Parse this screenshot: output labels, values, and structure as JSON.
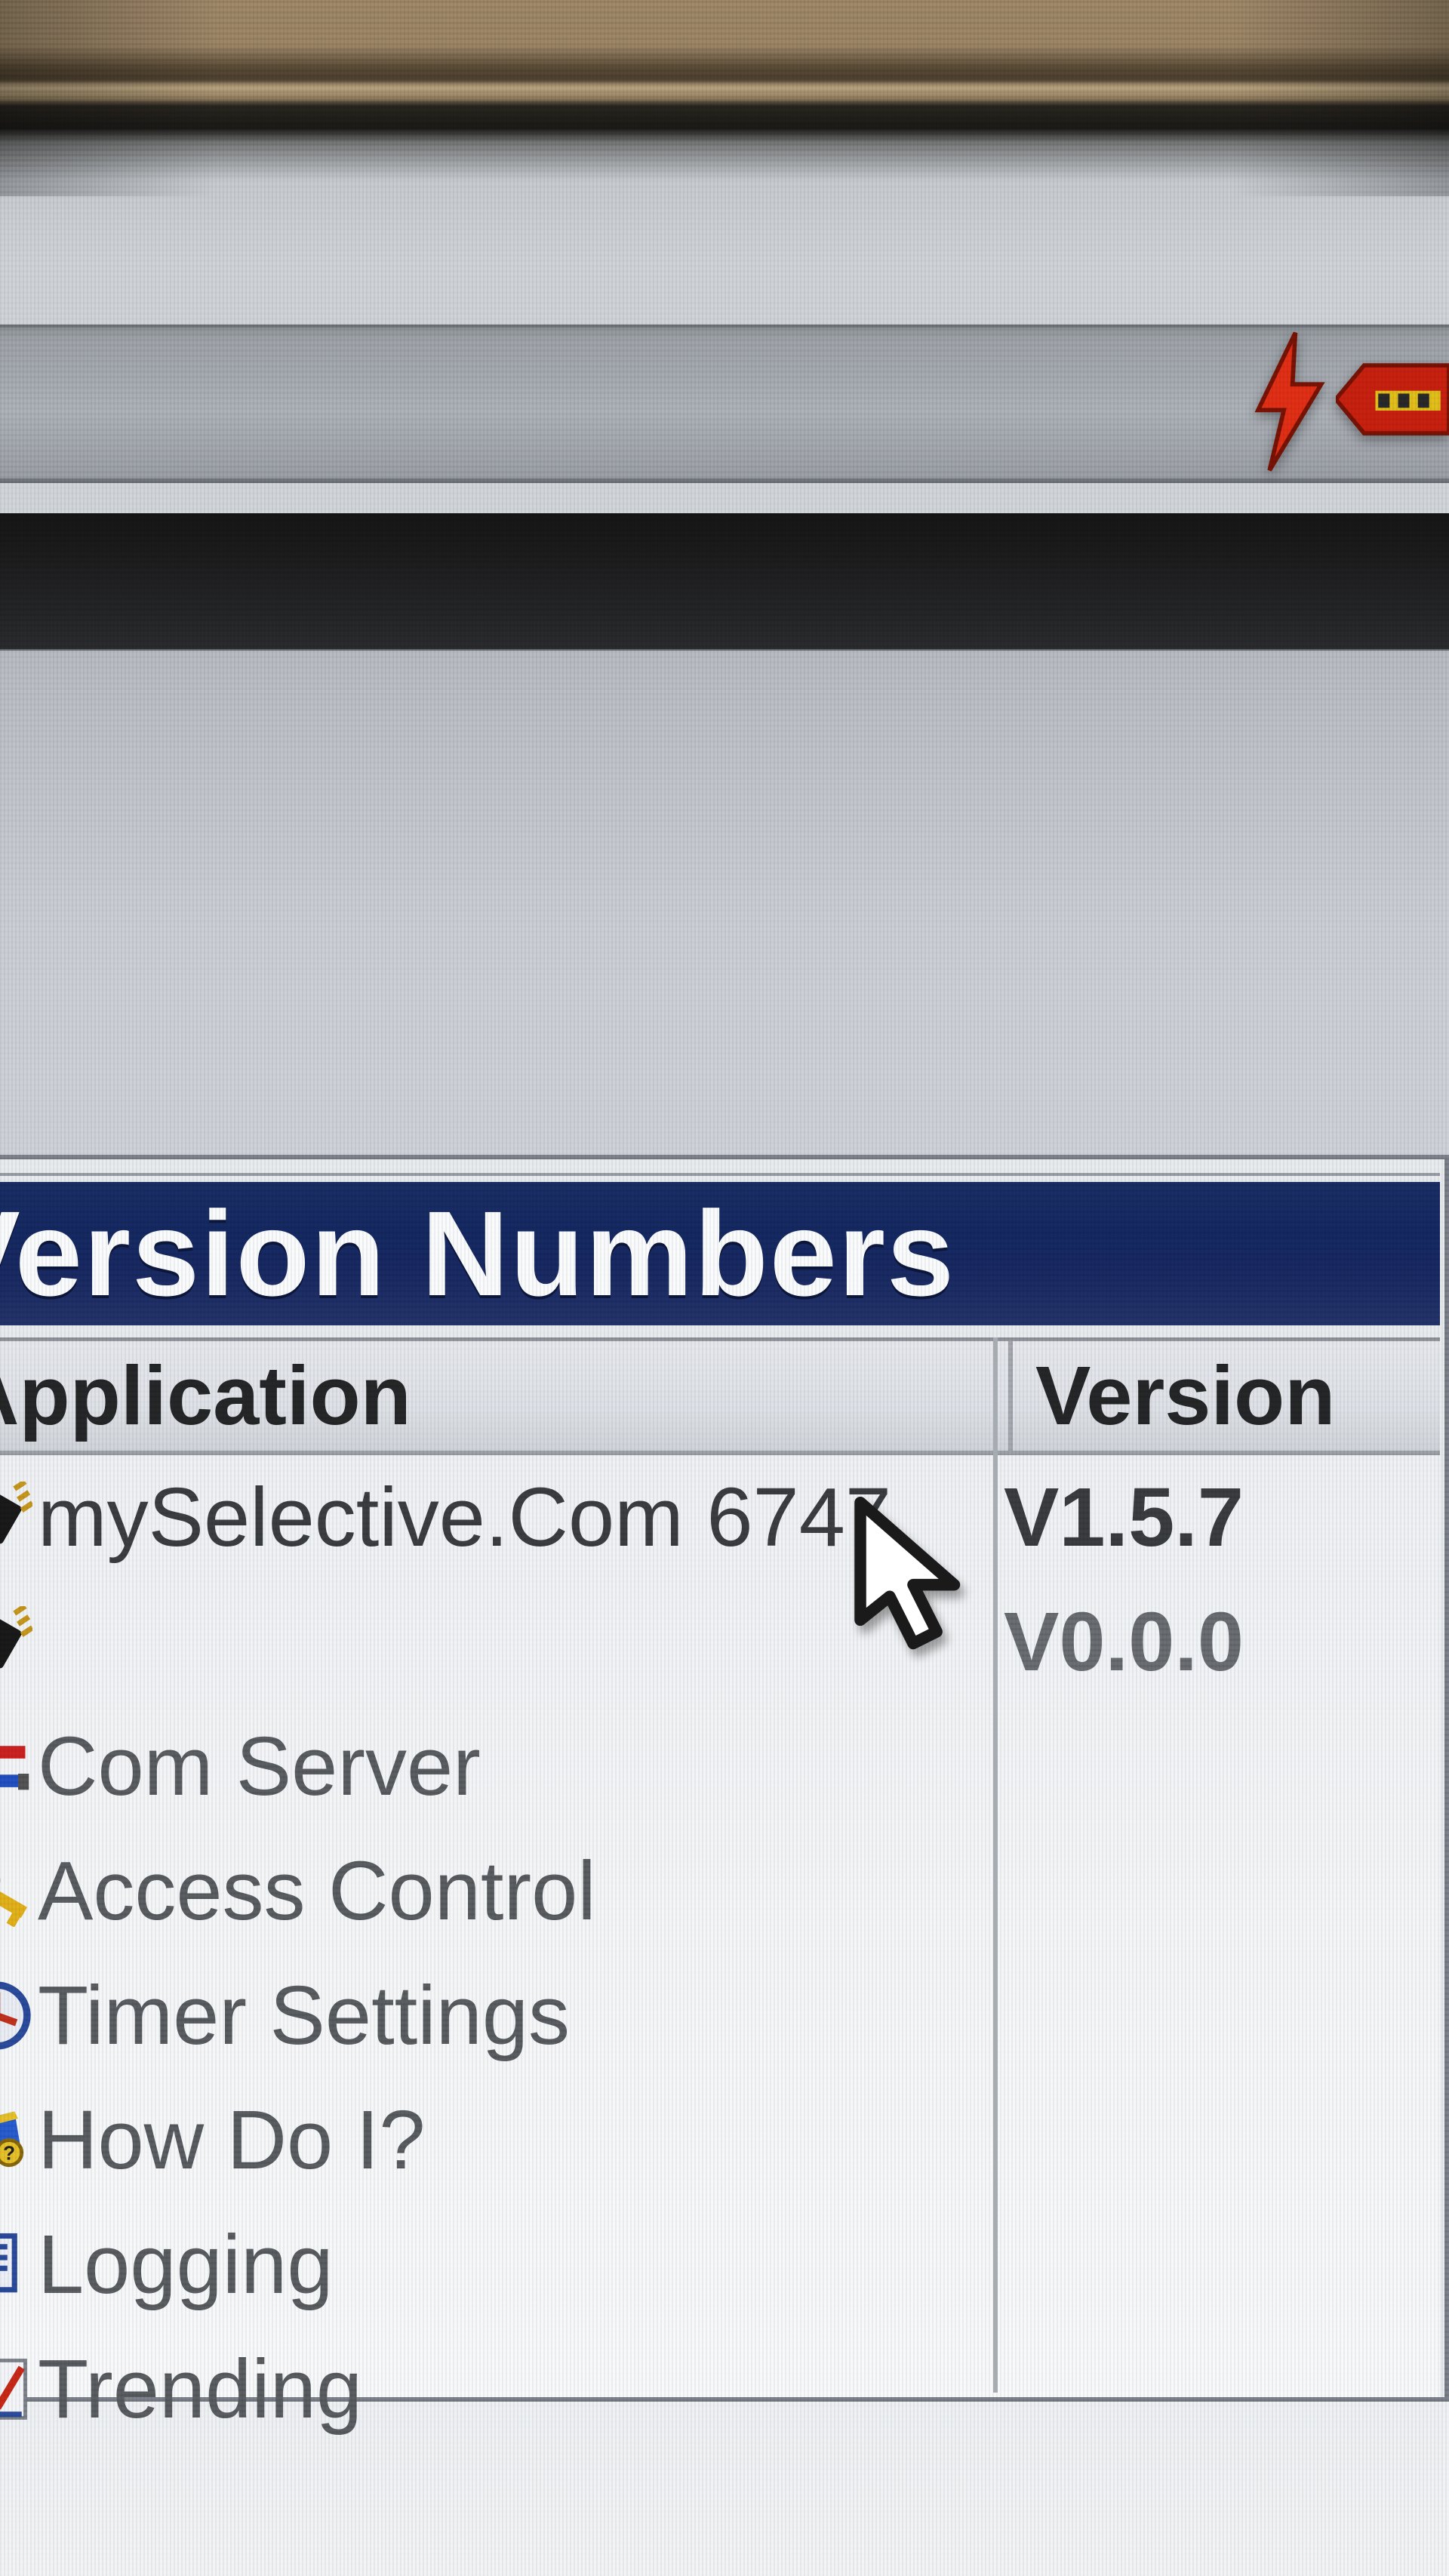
{
  "toolbar": {
    "icons": [
      "lightning-icon",
      "red-bar-icon"
    ]
  },
  "window": {
    "title": "Version Numbers",
    "columns": {
      "application": "Application",
      "version": "Version"
    },
    "rows": [
      {
        "icon": "chip-icon",
        "label": "mySelective.Com 6747",
        "version": "V1.5.7"
      },
      {
        "icon": "chip-icon",
        "label": "",
        "version": "V0.0.0"
      },
      {
        "icon": "wires-icon",
        "label": "Com Server",
        "version": ""
      },
      {
        "icon": "key-icon",
        "label": "Access Control",
        "version": ""
      },
      {
        "icon": "clock-icon",
        "label": "Timer Settings",
        "version": ""
      },
      {
        "icon": "book-icon",
        "label": "How Do I?",
        "version": ""
      },
      {
        "icon": "log-icon",
        "label": "Logging",
        "version": ""
      },
      {
        "icon": "trend-icon",
        "label": "Trending",
        "version": ""
      }
    ]
  }
}
